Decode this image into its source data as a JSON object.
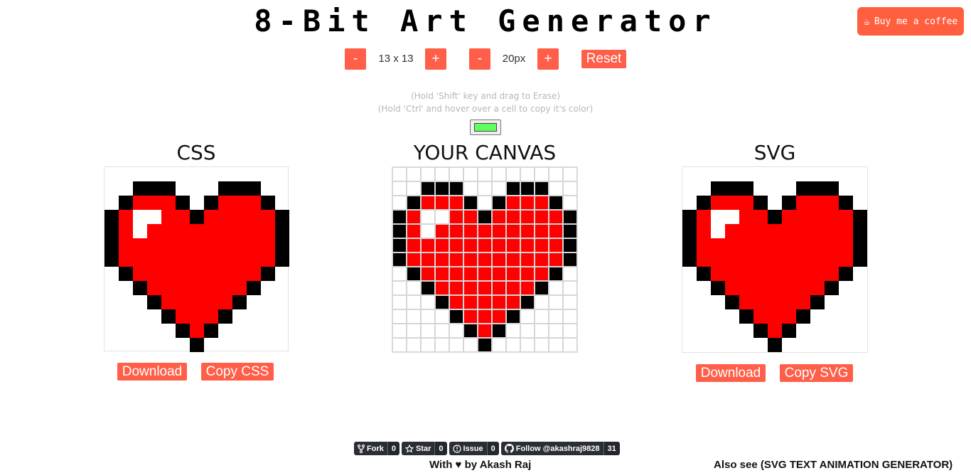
{
  "header": {
    "title": "8-Bit Art Generator",
    "coffee_label": "Buy me a coffee",
    "coffee_icon": "coffee-cup-icon",
    "accent_color": "#ff5f48"
  },
  "controls": {
    "grid_minus": "-",
    "grid_size": "13 x 13",
    "grid_plus": "+",
    "cell_minus": "-",
    "cell_size": "20px",
    "cell_plus": "+",
    "reset": "Reset"
  },
  "hints": {
    "erase": "(Hold 'Shift' key and drag to Erase)",
    "copy_color": "(Hold 'Ctrl' and hover over a cell to copy it's color)"
  },
  "color_picker": {
    "value": "#61ff5d"
  },
  "panels": {
    "css": {
      "title": "CSS",
      "download": "Download",
      "copy": "Copy CSS"
    },
    "canvas": {
      "title": "YOUR CANVAS"
    },
    "svg": {
      "title": "SVG",
      "download": "Download",
      "copy": "Copy SVG"
    }
  },
  "artwork": {
    "grid_size": 13,
    "palette": {
      "K": "#000000",
      "R": "#ff0000",
      "W": "#ffffff"
    },
    "rows": [
      ".............",
      "..KKK...KKK..",
      ".KRRRK.KRRRK.",
      "KRWWRRKRRRRRK",
      "KRWRRRRRRRRRK",
      "KRRRRRRRRRRRK",
      "KRRRRRRRRRRRK",
      ".KRRRRRRRRRK.",
      "..KRRRRRRRK..",
      "...KRRRRRK...",
      "....KRRRK....",
      ".....KRK.....",
      "......K......"
    ]
  },
  "footer": {
    "badges": [
      {
        "label": "Fork",
        "count": "0",
        "icon": "fork-icon"
      },
      {
        "label": "Star",
        "count": "0",
        "icon": "star-icon"
      },
      {
        "label": "Issue",
        "count": "0",
        "icon": "issue-icon"
      },
      {
        "label": "Follow @akashraj9828",
        "count": "31",
        "icon": "github-icon"
      }
    ],
    "credit_prefix": "With",
    "credit_suffix": "by Akash Raj",
    "also_see": "Also see (SVG TEXT ANIMATION GENERATOR)"
  }
}
